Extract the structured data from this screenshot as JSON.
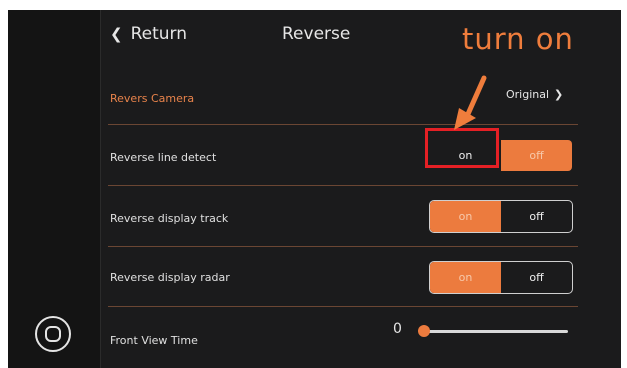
{
  "header": {
    "back_label": "Return",
    "title": "Reverse",
    "annotation": "turn on"
  },
  "rows": {
    "camera": {
      "label": "Revers Camera",
      "value": "Original"
    },
    "line_detect": {
      "label": "Reverse line detect",
      "on_label": "on",
      "off_label": "off",
      "selected": "off"
    },
    "display_track": {
      "label": "Reverse display track",
      "on_label": "on",
      "off_label": "off",
      "selected": "on"
    },
    "display_radar": {
      "label": "Reverse display radar",
      "on_label": "on",
      "off_label": "off",
      "selected": "on"
    },
    "front_view": {
      "label": "Front View Time",
      "value": "0"
    }
  },
  "icons": {
    "back": "chevron-left-icon",
    "original": "chevron-right-icon",
    "home": "home-button-icon",
    "annotation_arrow": "arrow-icon"
  },
  "colors": {
    "accent": "#ec7b3e",
    "highlight": "#e52025",
    "background": "#1b1b1c"
  }
}
